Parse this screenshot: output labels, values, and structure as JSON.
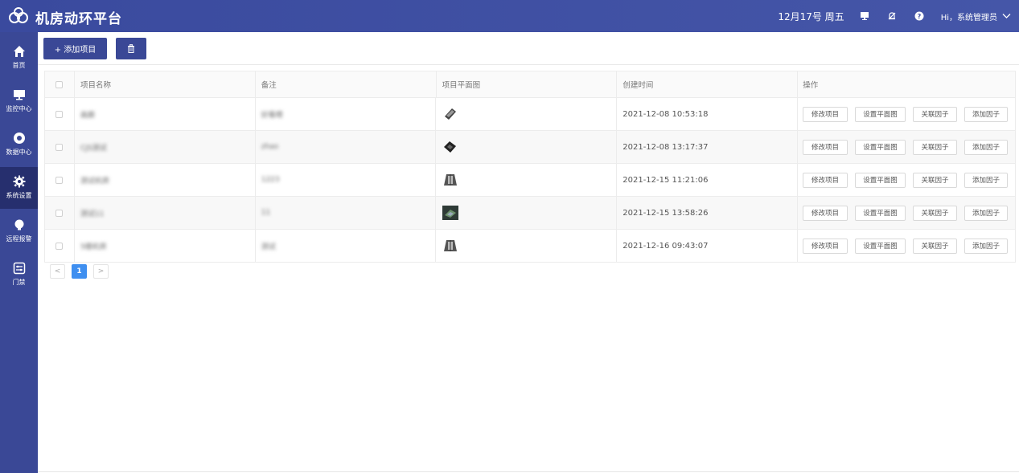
{
  "app": {
    "title": "机房动环平台"
  },
  "header": {
    "date": "12月17号 周五",
    "user_greeting": "Hi，系统管理员"
  },
  "sidebar": {
    "items": [
      {
        "label": "首页",
        "icon": "home-icon"
      },
      {
        "label": "监控中心",
        "icon": "monitor-icon"
      },
      {
        "label": "数据中心",
        "icon": "lifebuoy-icon"
      },
      {
        "label": "系统设置",
        "icon": "gear-icon",
        "active": true
      },
      {
        "label": "远程报警",
        "icon": "bulb-icon"
      },
      {
        "label": "门禁",
        "icon": "door-panel-icon"
      }
    ]
  },
  "toolbar": {
    "add_label": "+ 添加项目"
  },
  "table": {
    "columns": [
      "项目名称",
      "备注",
      "项目平面图",
      "创建时间",
      "操作"
    ],
    "rows": [
      {
        "name": "画廊",
        "note": "好看嗯",
        "created": "2021-12-08 10:53:18"
      },
      {
        "name": "CJS测试",
        "note": "zhao",
        "created": "2021-12-08 13:17:37"
      },
      {
        "name": "测试机房",
        "note": "1223",
        "created": "2021-12-15 11:21:06"
      },
      {
        "name": "测试11",
        "note": "11",
        "created": "2021-12-15 13:58:26"
      },
      {
        "name": "5楼机房",
        "note": "测试",
        "created": "2021-12-16 09:43:07"
      }
    ],
    "actions": [
      "修改项目",
      "设置平面图",
      "关联因子",
      "添加因子"
    ]
  },
  "pagination": {
    "prev": "<",
    "current": "1",
    "next": ">"
  }
}
